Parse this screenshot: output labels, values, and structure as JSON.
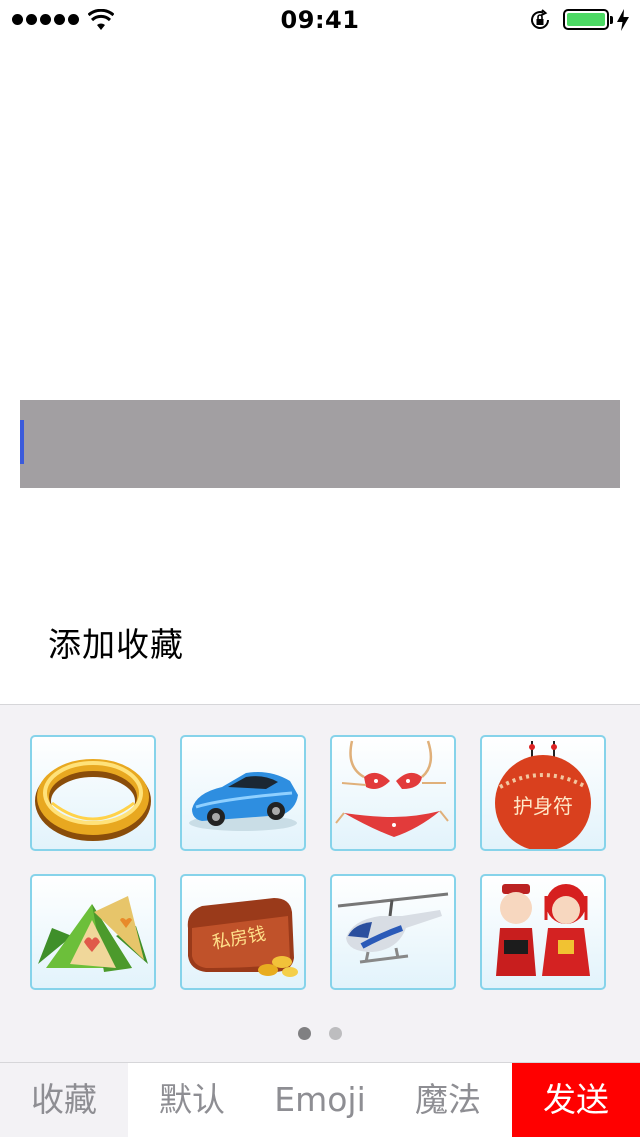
{
  "status_bar": {
    "time": "09:41",
    "signal_bars": 5,
    "battery_percent": 100,
    "battery_color": "#4cd964"
  },
  "input": {
    "value": ""
  },
  "add_favorite_label": "添加收藏",
  "gifts": [
    {
      "name": "gold-ring-icon"
    },
    {
      "name": "blue-sports-car-icon"
    },
    {
      "name": "bikini-icon"
    },
    {
      "name": "amulet-icon"
    },
    {
      "name": "zongzi-icon"
    },
    {
      "name": "private-money-wallet-icon"
    },
    {
      "name": "helicopter-icon"
    },
    {
      "name": "wedding-couple-icon"
    }
  ],
  "gift_texts": {
    "amulet": "护身符",
    "wallet": "私房钱"
  },
  "page_indicator": {
    "pages": 2,
    "current": 1
  },
  "tabs": [
    {
      "label": "收藏",
      "selected": true
    },
    {
      "label": "默认",
      "selected": false
    },
    {
      "label": "Emoji",
      "selected": false
    },
    {
      "label": "魔法",
      "selected": false
    }
  ],
  "send_label": "发送",
  "colors": {
    "send": "#ff0000",
    "input_bg": "#a29fa2",
    "cursor": "#3b5bdb",
    "cell_border": "#86d3ea"
  }
}
